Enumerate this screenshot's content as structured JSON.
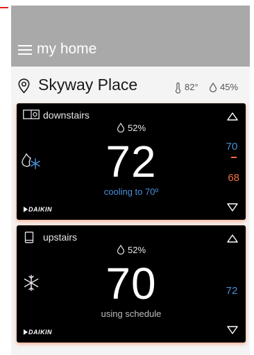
{
  "header": {
    "title": "my home"
  },
  "location": {
    "name": "Skyway Place",
    "outdoor_temp": "82°",
    "outdoor_humidity": "45%"
  },
  "zones": [
    {
      "name": "downstairs",
      "humidity": "52%",
      "temperature": "72",
      "status": "cooling to 70º",
      "cool_setpoint": "70",
      "heat_setpoint": "68",
      "brand": "DAIKIN"
    },
    {
      "name": "upstairs",
      "humidity": "52%",
      "temperature": "70",
      "status": "using schedule",
      "cool_setpoint": "72",
      "brand": "DAIKIN"
    }
  ],
  "colors": {
    "cool": "#4a90d9",
    "heat": "#f07040",
    "card_glow": "#f88c64",
    "header": "#a9a9a9"
  }
}
